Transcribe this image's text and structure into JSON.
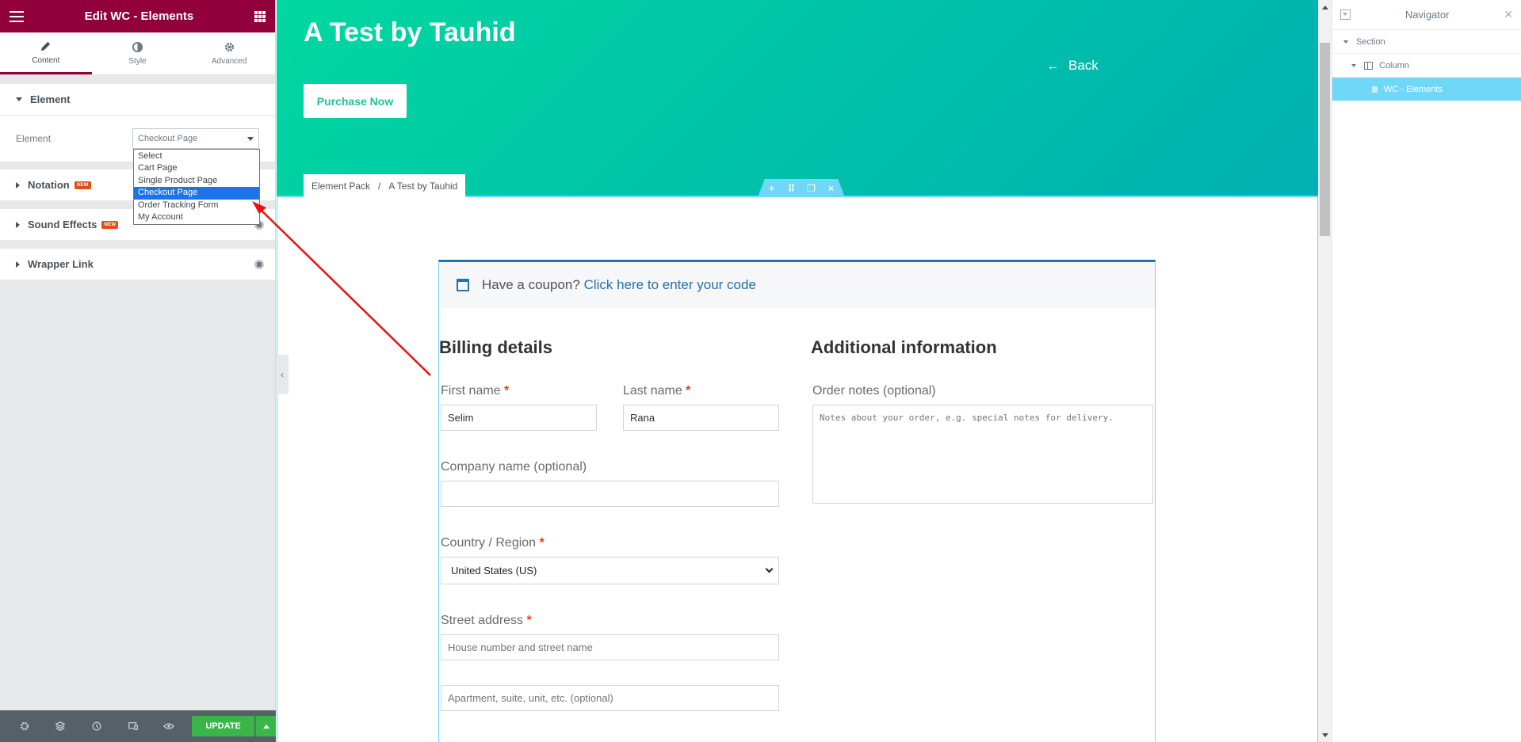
{
  "panel": {
    "title": "Edit WC - Elements",
    "tabs": [
      {
        "label": "Content",
        "icon": "pencil-icon"
      },
      {
        "label": "Style",
        "icon": "half-circle-icon"
      },
      {
        "label": "Advanced",
        "icon": "gear-icon"
      }
    ],
    "sections": {
      "element": "Element",
      "notation": "Notation",
      "sound_effects": "Sound Effects",
      "wrapper_link": "Wrapper Link",
      "new_badge": "NEW"
    },
    "control": {
      "label": "Element",
      "value": "Checkout Page"
    },
    "dropdown_options": [
      "Select",
      "Cart Page",
      "Single Product Page",
      "Checkout Page",
      "Order Tracking Form",
      "My Account"
    ],
    "dropdown_selected": "Checkout Page",
    "footer": {
      "update_label": "UPDATE"
    },
    "accent_color": "#92003b"
  },
  "preview": {
    "hero_title": "A Test by Tauhid",
    "purchase_label": "Purchase Now",
    "back_label": "Back",
    "breadcrumb": [
      "Element Pack",
      "/",
      "A Test by Tauhid"
    ],
    "checkout": {
      "coupon_text": "Have a coupon?",
      "coupon_link": "Click here to enter your code",
      "billing_title": "Billing details",
      "additional_title": "Additional information",
      "first_name_label": "First name",
      "first_name_value": "Selim",
      "last_name_label": "Last name",
      "last_name_value": "Rana",
      "company_label": "Company name (optional)",
      "country_label": "Country / Region",
      "country_value": "United States (US)",
      "street_label": "Street address",
      "street_placeholder": "House number and street name",
      "apartment_placeholder": "Apartment, suite, unit, etc. (optional)",
      "order_notes_label": "Order notes (optional)",
      "order_notes_placeholder": "Notes about your order, e.g. special notes for delivery.",
      "required_mark": "*"
    }
  },
  "navigator": {
    "title": "Navigator",
    "items": [
      {
        "label": "Section"
      },
      {
        "label": "Column"
      },
      {
        "label": "WC - Elements"
      }
    ]
  }
}
